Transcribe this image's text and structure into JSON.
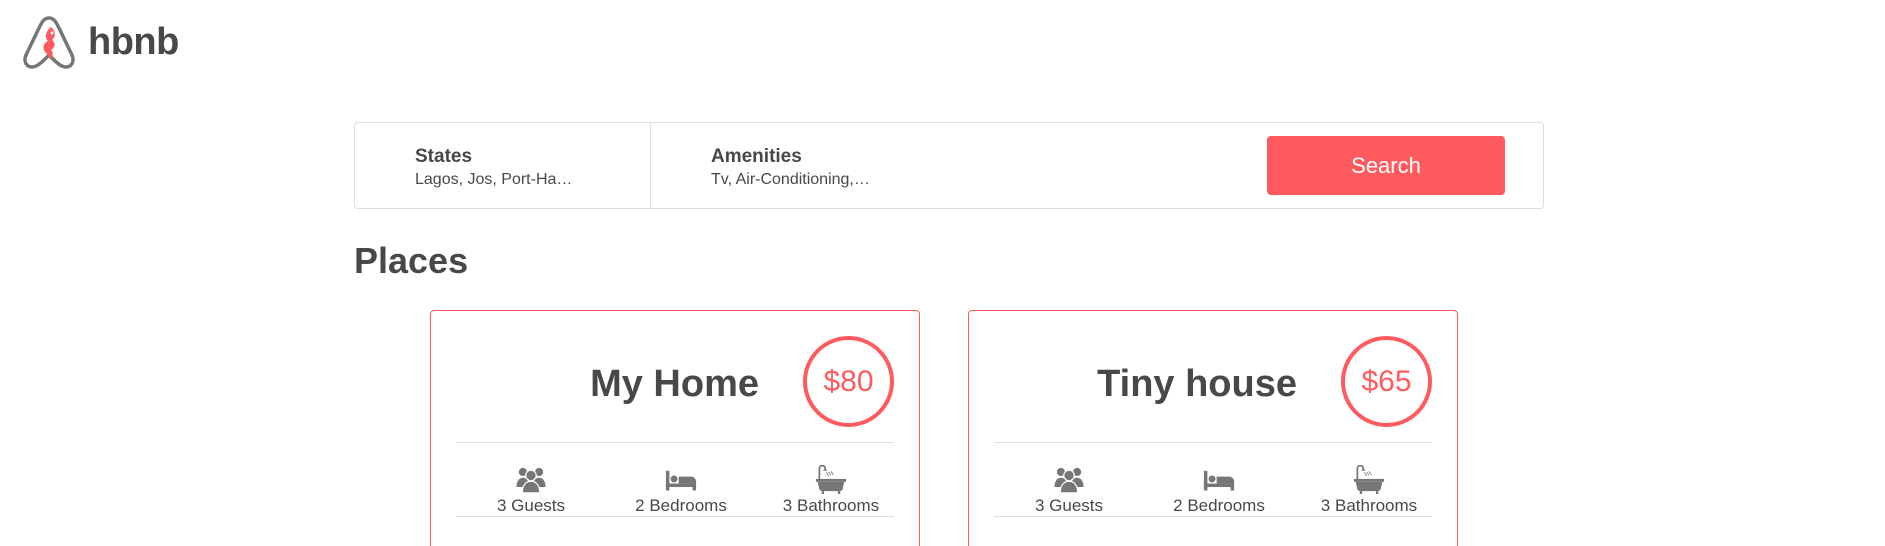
{
  "header": {
    "logo_text": "hbnb",
    "logo_icon": "airbnb-logo-icon"
  },
  "filters": {
    "states": {
      "title": "States",
      "value": "Lagos, Jos, Port-Ha…"
    },
    "amenities": {
      "title": "Amenities",
      "value": "Tv, Air-Conditioning,…"
    },
    "search_label": "Search"
  },
  "places": {
    "title": "Places",
    "items": [
      {
        "name": "My Home",
        "price": "$80",
        "guests": "3 Guests",
        "bedrooms": "2 Bedrooms",
        "bathrooms": "3 Bathrooms"
      },
      {
        "name": "Tiny house",
        "price": "$65",
        "guests": "3 Guests",
        "bedrooms": "2 Bedrooms",
        "bathrooms": "3 Bathrooms"
      }
    ]
  },
  "colors": {
    "accent": "#ff5a5f",
    "text": "#484848",
    "border": "#dddddd",
    "icon": "#767676"
  }
}
